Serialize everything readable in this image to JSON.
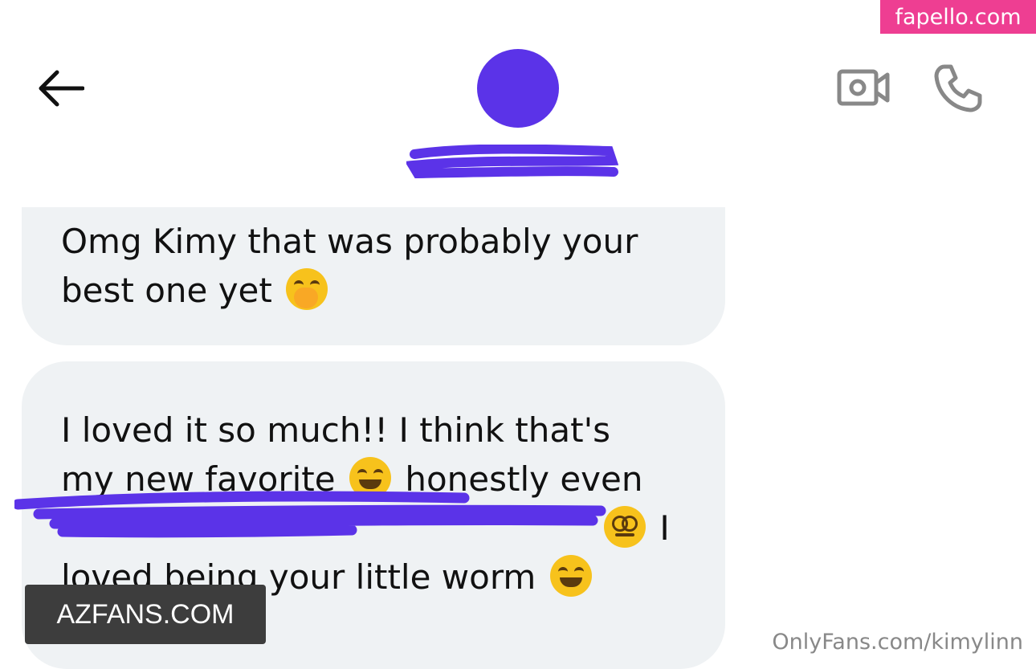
{
  "watermark_badge": "fapello.com",
  "header": {
    "back_icon": "arrow-left-icon",
    "avatar_icon": "avatar",
    "video_icon": "video-camera-icon",
    "phone_icon": "phone-icon",
    "avatar_color": "#5b33e8"
  },
  "messages": [
    {
      "lines": [
        "Omg Kimy that was probably your",
        "best one yet"
      ]
    },
    {
      "lines": [
        "I loved it so much!! I think that's",
        "my new favorite",
        "honestly even",
        "I",
        "loved being your little worm"
      ]
    }
  ],
  "watermark_az": "AZFANS.COM",
  "watermark_of": "OnlyFans.com/kimylinn",
  "colors": {
    "bubble": "#eff2f4",
    "redaction": "#5b33e8",
    "badge": "#ee3e92"
  }
}
